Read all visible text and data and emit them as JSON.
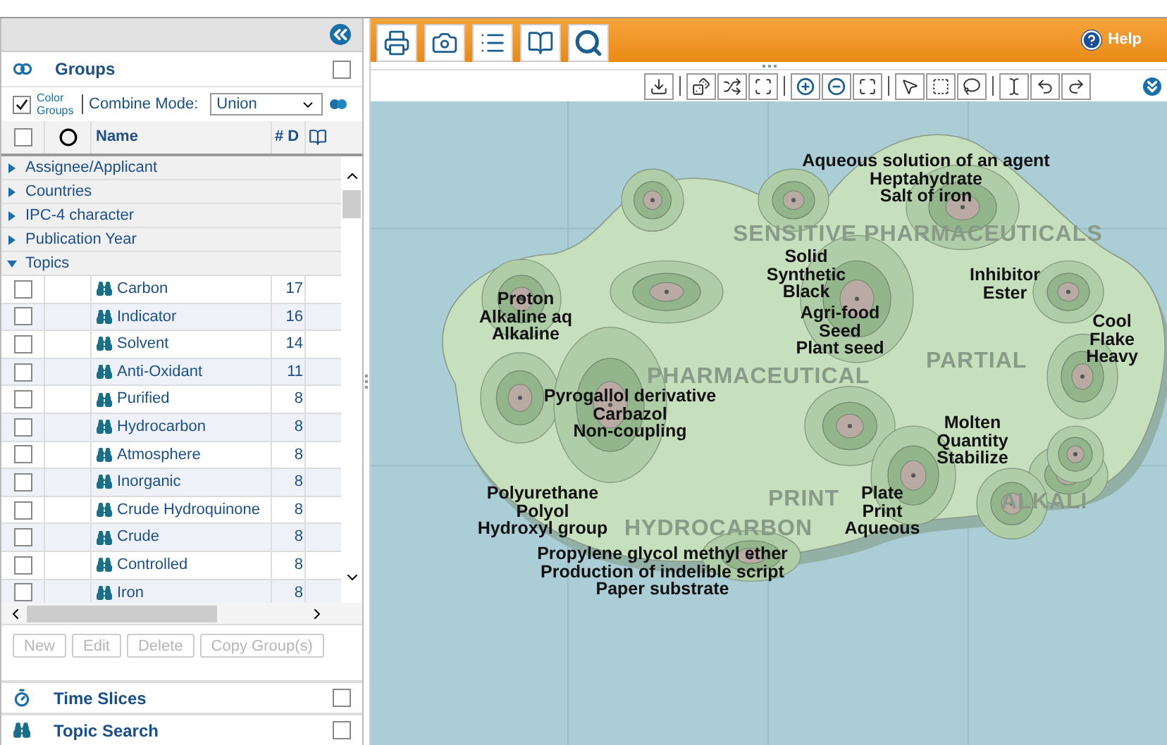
{
  "groups_section": {
    "title": "Groups",
    "checked": false
  },
  "color_groups": {
    "label": "Color Groups",
    "checked": true
  },
  "combine_mode": {
    "label": "Combine Mode:",
    "value": "Union"
  },
  "select_all": {
    "checked": false
  },
  "columns": [
    "Name",
    "# D"
  ],
  "tree": [
    {
      "label": "Assignee/Applicant",
      "expanded": false
    },
    {
      "label": "Countries",
      "expanded": false
    },
    {
      "label": "IPC-4 character",
      "expanded": false
    },
    {
      "label": "Publication Year",
      "expanded": false
    },
    {
      "label": "Topics",
      "expanded": true,
      "children": [
        {
          "name": "Carbon",
          "count": "17",
          "checked": false
        },
        {
          "name": "Indicator",
          "count": "16",
          "checked": false
        },
        {
          "name": "Solvent",
          "count": "14",
          "checked": false
        },
        {
          "name": "Anti-Oxidant",
          "count": "11",
          "checked": false
        },
        {
          "name": "Purified",
          "count": "8",
          "checked": false
        },
        {
          "name": "Hydrocarbon",
          "count": "8",
          "checked": false
        },
        {
          "name": "Atmosphere",
          "count": "8",
          "checked": false
        },
        {
          "name": "Inorganic",
          "count": "8",
          "checked": false
        },
        {
          "name": "Crude Hydroquinone",
          "count": "8",
          "checked": false
        },
        {
          "name": "Crude",
          "count": "8",
          "checked": false
        },
        {
          "name": "Controlled",
          "count": "8",
          "checked": false
        },
        {
          "name": "Iron",
          "count": "8",
          "checked": false
        }
      ]
    }
  ],
  "buttons": [
    {
      "label": "New",
      "disabled": true
    },
    {
      "label": "Edit",
      "disabled": true
    },
    {
      "label": "Delete",
      "disabled": true
    },
    {
      "label": "Copy Group(s)",
      "disabled": true
    }
  ],
  "sections": [
    {
      "title": "Time Slices",
      "checked": false,
      "kind": "time"
    },
    {
      "title": "Topic Search",
      "checked": false,
      "kind": "search"
    }
  ],
  "help": "Help",
  "map": {
    "regions": [
      "SENSITIVE PHARMACEUTICALS",
      "PHARMACEUTICAL",
      "PARTIAL",
      "PRINT",
      "ALKALI",
      "HYDROCARBON"
    ],
    "clusters": [
      {
        "terms": [
          "Aqueous solution of an agent",
          "Heptahydrate",
          "Salt of iron"
        ]
      },
      {
        "terms": [
          "Solid",
          "Synthetic",
          "Black"
        ]
      },
      {
        "terms": [
          "Proton",
          "Alkaline aq",
          "Alkaline"
        ]
      },
      {
        "terms": [
          "Agri-food",
          "Seed",
          "Plant seed"
        ]
      },
      {
        "terms": [
          "Inhibitor",
          "Ester"
        ]
      },
      {
        "terms": [
          "Cool",
          "Flake",
          "Heavy"
        ]
      },
      {
        "terms": [
          "Pyrogallol derivative",
          "Carbazol",
          "Non-coupling"
        ]
      },
      {
        "terms": [
          "Molten",
          "Quantity",
          "Stabilize"
        ]
      },
      {
        "terms": [
          "Polyurethane",
          "Polyol",
          "Hydroxyl group"
        ]
      },
      {
        "terms": [
          "Plate",
          "Print",
          "Aqueous"
        ]
      },
      {
        "terms": [
          "Propylene glycol methyl ether",
          "Production of indelible script",
          "Paper substrate"
        ]
      }
    ]
  }
}
